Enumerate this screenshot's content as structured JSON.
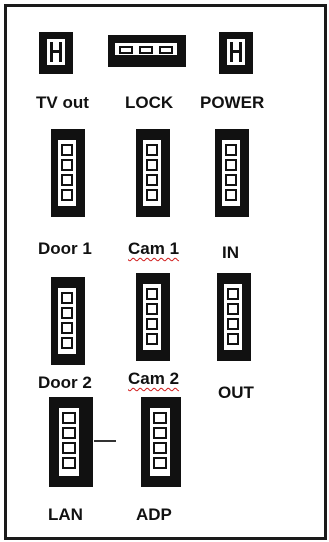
{
  "board": {
    "tv_out": {
      "label": "TV out"
    },
    "lock": {
      "label": "LOCK"
    },
    "power": {
      "label": "POWER"
    },
    "door1": {
      "label": "Door 1"
    },
    "cam1": {
      "label": "Cam 1"
    },
    "in": {
      "label": "IN"
    },
    "door2": {
      "label": "Door 2"
    },
    "cam2": {
      "label": "Cam 2"
    },
    "out": {
      "label": "OUT"
    },
    "lan": {
      "label": "LAN"
    },
    "adp": {
      "label": "ADP"
    }
  },
  "colors": {
    "connector_fill": "#111111",
    "border": "#1a1a1a",
    "spellcheck_underline": "#d01818"
  },
  "icons": {
    "two_pin": "two-pin-connector-icon",
    "three_pin_horizontal": "three-pin-horizontal-connector-icon",
    "four_pin_vertical": "four-pin-vertical-connector-icon"
  }
}
